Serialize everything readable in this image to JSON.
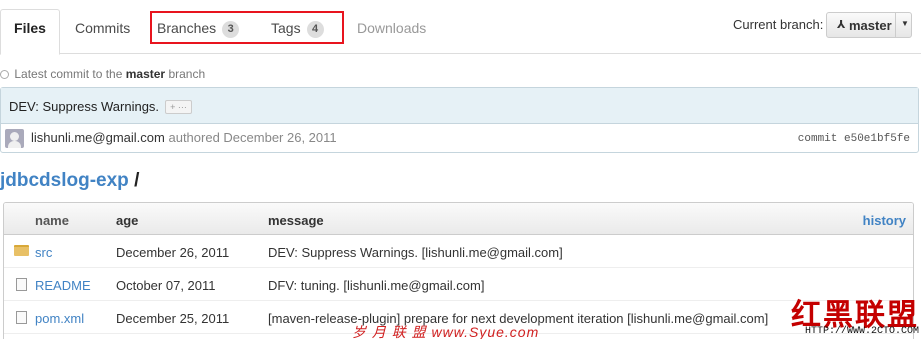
{
  "tabs": {
    "files": "Files",
    "commits": "Commits",
    "branches": "Branches",
    "branches_count": "3",
    "tags": "Tags",
    "tags_count": "4",
    "downloads": "Downloads"
  },
  "branch_selector": {
    "label": "Current branch:",
    "value": "master"
  },
  "latest_commit": {
    "prefix": "Latest commit to the",
    "branch": "master",
    "suffix": "branch"
  },
  "commit": {
    "message": "DEV: Suppress Warnings.",
    "expander": "+ ···",
    "author": "lishunli.me@gmail.com",
    "authored": "authored December 26, 2011",
    "sha_label": "commit e50e1bf5fe"
  },
  "path": {
    "repo": "jdbcdslog-exp",
    "separator": "/"
  },
  "table": {
    "headers": {
      "name": "name",
      "age": "age",
      "message": "message",
      "history": "history"
    },
    "rows": [
      {
        "type": "folder",
        "name": "src",
        "age": "December 26, 2011",
        "message": "DEV: Suppress Warnings. [lishunli.me@gmail.com]"
      },
      {
        "type": "file",
        "name": "README",
        "age": "October 07, 2011",
        "message": "DFV: tuning. [lishunli.me@gmail.com]"
      },
      {
        "type": "file",
        "name": "pom.xml",
        "age": "December 25, 2011",
        "message": "[maven-release-plugin] prepare for next development iteration [lishunli.me@gmail.com]"
      }
    ]
  },
  "watermark": {
    "logo": "红黑联盟",
    "url": "HTTP://WWW.2CTO.COM",
    "bottom": "岁 月 联 盟  www.Syue.com"
  },
  "colors": {
    "link": "#4183c4",
    "highlight_box": "#e8141e",
    "commit_bg": "#e6f1f6"
  }
}
